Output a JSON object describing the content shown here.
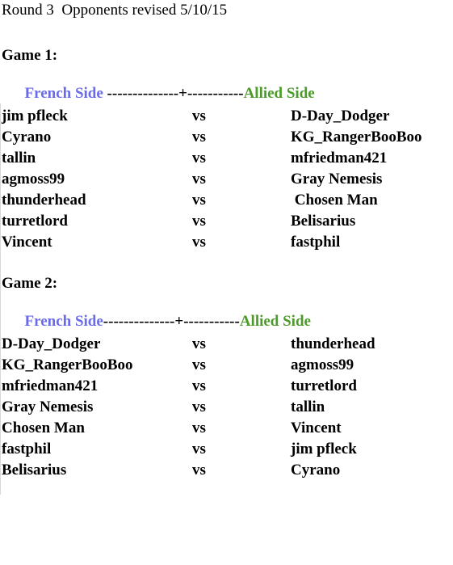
{
  "document": {
    "title": "Round 3  Opponents revised 5/10/15",
    "background_color": "#ffffff",
    "text_color": "#000000",
    "french_side_color": "#6b6be8",
    "allied_side_color": "#4c9a2a"
  },
  "games": [
    {
      "heading": "Game 1:",
      "header": {
        "left_label": "French Side",
        "separator": " --------------+-----------",
        "right_label": "Allied Side"
      },
      "vs_label": "vs",
      "matchups": [
        {
          "french": "jim pfleck",
          "vs": "vs",
          "allied": "D-Day_Dodger"
        },
        {
          "french": "Cyrano",
          "vs": "vs",
          "allied": "KG_RangerBooBoo"
        },
        {
          "french": "tallin",
          "vs": "vs",
          "allied": "mfriedman421"
        },
        {
          "french": "agmoss99",
          "vs": "vs",
          "allied": "Gray Nemesis"
        },
        {
          "french": "thunderhead",
          "vs": "vs",
          "allied": " Chosen Man"
        },
        {
          "french": "turretlord",
          "vs": "vs",
          "allied": "Belisarius"
        },
        {
          "french": "Vincent",
          "vs": "vs",
          "allied": "fastphil"
        }
      ]
    },
    {
      "heading": "Game 2:",
      "header": {
        "left_label": "French Side",
        "separator": "--------------+-----------",
        "right_label": "Allied Side"
      },
      "vs_label": "vs",
      "matchups": [
        {
          "french": "D-Day_Dodger",
          "vs": "vs",
          "allied": "thunderhead"
        },
        {
          "french": "KG_RangerBooBoo",
          "vs": "vs",
          "allied": "agmoss99"
        },
        {
          "french": "mfriedman421",
          "vs": "vs",
          "allied": "turretlord"
        },
        {
          "french": "Gray Nemesis",
          "vs": "vs",
          "allied": "tallin"
        },
        {
          "french": "Chosen Man",
          "vs": "vs",
          "allied": "Vincent"
        },
        {
          "french": "fastphil",
          "vs": "vs",
          "allied": "jim pfleck"
        },
        {
          "french": "Belisarius",
          "vs": "vs",
          "allied": "Cyrano"
        }
      ]
    }
  ]
}
